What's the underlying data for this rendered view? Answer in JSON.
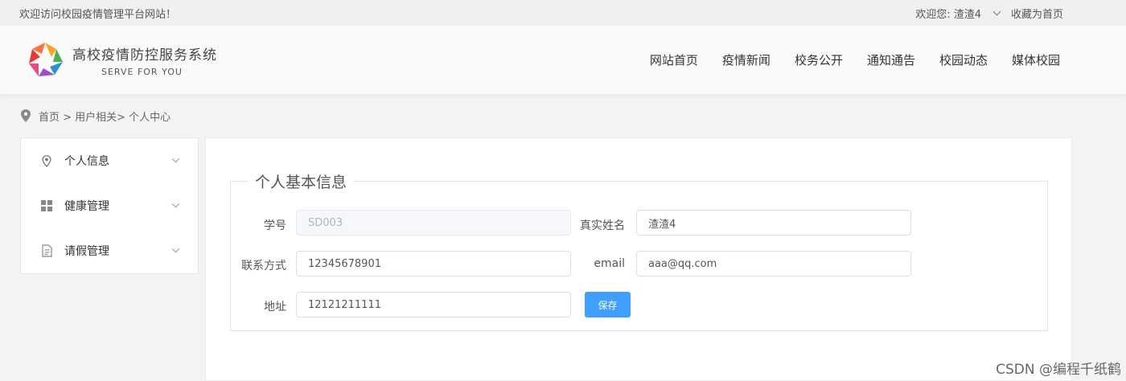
{
  "topbar": {
    "welcome_text": "欢迎访问校园疫情管理平台网站！",
    "user_greeting": "欢迎您: 渣渣4",
    "bookmark_label": "收藏为首页"
  },
  "header": {
    "site_title": "高校疫情防控服务系统",
    "site_subtitle": "SERVE FOR YOU",
    "nav": [
      "网站首页",
      "疫情新闻",
      "校务公开",
      "通知通告",
      "校园动态",
      "媒体校园"
    ]
  },
  "breadcrumb": {
    "text": "首页 > 用户相关> 个人中心"
  },
  "sidebar": {
    "items": [
      {
        "label": "个人信息",
        "icon": "location-pin-icon"
      },
      {
        "label": "健康管理",
        "icon": "grid-icon"
      },
      {
        "label": "请假管理",
        "icon": "document-icon"
      }
    ]
  },
  "form": {
    "legend": "个人基本信息",
    "student_id_label": "学号",
    "student_id_value": "SD003",
    "real_name_label": "真实姓名",
    "real_name_value": "渣渣4",
    "phone_label": "联系方式",
    "phone_value": "12345678901",
    "email_label": "email",
    "email_value": "aaa@qq.com",
    "address_label": "地址",
    "address_value": "12121211111",
    "save_label": "保存"
  },
  "watermark": "CSDN @编程千纸鹤",
  "colors": {
    "primary": "#409eff",
    "background": "#f3f3f3"
  }
}
